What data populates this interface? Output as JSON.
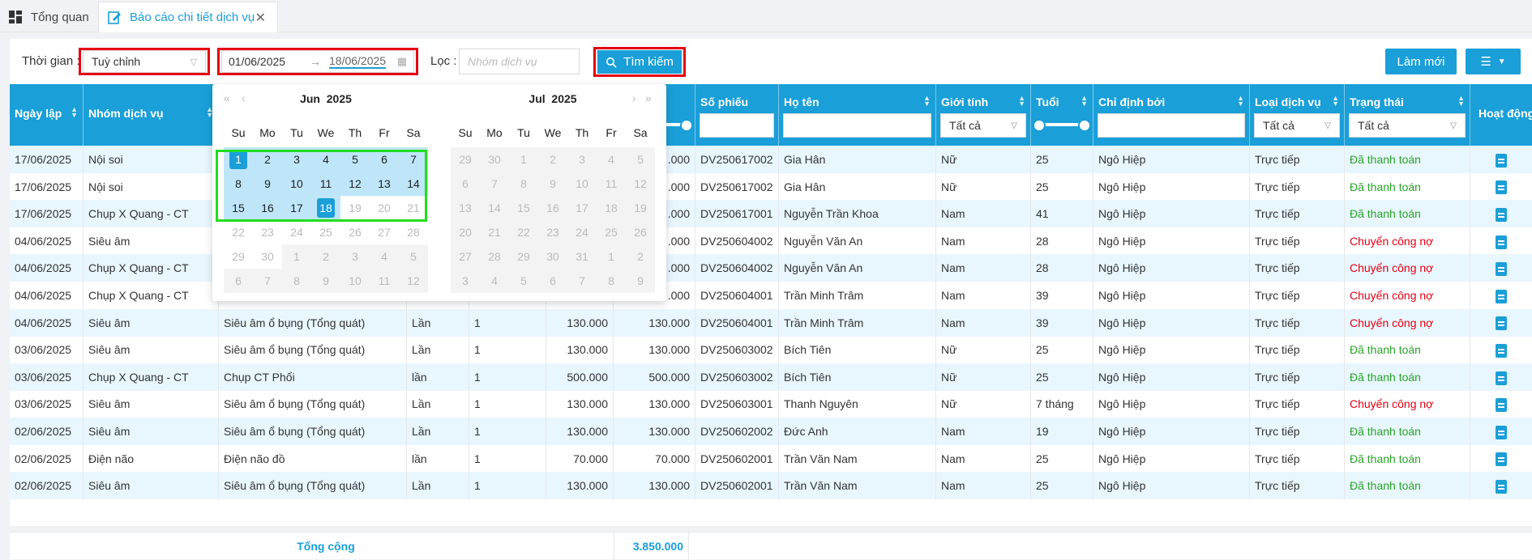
{
  "tabs": [
    {
      "label": "Tổng quan"
    },
    {
      "label": "Báo cáo chi tiết dịch vụ"
    }
  ],
  "filters": {
    "time_label": "Thời gian :",
    "time_value": "Tuỳ chỉnh",
    "date_from": "01/06/2025",
    "date_to": "18/06/2025",
    "filter_label": "Lọc :",
    "service_placeholder": "Nhóm dịch vụ",
    "search_label": "Tìm kiếm",
    "refresh_label": "Làm mới"
  },
  "table": {
    "headers": {
      "date": "Ngày lập",
      "group": "Nhóm dịch vụ",
      "ticket": "Số phiếu",
      "name": "Họ tên",
      "gender": "Giới tính",
      "age": "Tuổi",
      "assigned_by": "Chỉ định bởi",
      "service_type": "Loại dịch vụ",
      "status": "Trạng thái",
      "action": "Hoạt động"
    },
    "header_filters": {
      "gender": "Tất cả",
      "service_type": "Tất cả",
      "status": "Tất cả"
    },
    "rows": [
      {
        "date": "17/06/2025",
        "group": "Nội soi",
        "service": "",
        "unit": "",
        "qty": "",
        "price": "",
        "amount": ".000",
        "ticket": "DV250617002",
        "name": "Gia Hân",
        "gender": "Nữ",
        "age": "25",
        "by": "Ngô Hiệp",
        "type": "Trực tiếp",
        "status": "Đã thanh toán",
        "paid": true
      },
      {
        "date": "17/06/2025",
        "group": "Nội soi",
        "service": "",
        "unit": "",
        "qty": "",
        "price": "",
        "amount": ".000",
        "ticket": "DV250617002",
        "name": "Gia Hân",
        "gender": "Nữ",
        "age": "25",
        "by": "Ngô Hiệp",
        "type": "Trực tiếp",
        "status": "Đã thanh toán",
        "paid": true
      },
      {
        "date": "17/06/2025",
        "group": "Chụp X Quang - CT",
        "service": "",
        "unit": "",
        "qty": "",
        "price": "",
        "amount": ".000",
        "ticket": "DV250617001",
        "name": "Nguyễn Trần Khoa",
        "gender": "Nam",
        "age": "41",
        "by": "Ngô Hiệp",
        "type": "Trực tiếp",
        "status": "Đã thanh toán",
        "paid": true
      },
      {
        "date": "04/06/2025",
        "group": "Siêu âm",
        "service": "",
        "unit": "",
        "qty": "",
        "price": "",
        "amount": ".000",
        "ticket": "DV250604002",
        "name": "Nguyễn Văn An",
        "gender": "Nam",
        "age": "28",
        "by": "Ngô Hiệp",
        "type": "Trực tiếp",
        "status": "Chuyển công nợ",
        "paid": false
      },
      {
        "date": "04/06/2025",
        "group": "Chụp X Quang - CT",
        "service": "",
        "unit": "",
        "qty": "",
        "price": "",
        "amount": ".000",
        "ticket": "DV250604002",
        "name": "Nguyễn Văn An",
        "gender": "Nam",
        "age": "28",
        "by": "Ngô Hiệp",
        "type": "Trực tiếp",
        "status": "Chuyển công nợ",
        "paid": false
      },
      {
        "date": "04/06/2025",
        "group": "Chụp X Quang - CT",
        "service": "",
        "unit": "",
        "qty": "",
        "price": "",
        "amount": ".000",
        "ticket": "DV250604001",
        "name": "Trần Minh Trâm",
        "gender": "Nam",
        "age": "39",
        "by": "Ngô Hiệp",
        "type": "Trực tiếp",
        "status": "Chuyển công nợ",
        "paid": false
      },
      {
        "date": "04/06/2025",
        "group": "Siêu âm",
        "service": "Siêu âm ổ bụng (Tổng quát)",
        "unit": "Lần",
        "qty": "1",
        "price": "130.000",
        "amount": "130.000",
        "ticket": "DV250604001",
        "name": "Trần Minh Trâm",
        "gender": "Nam",
        "age": "39",
        "by": "Ngô Hiệp",
        "type": "Trực tiếp",
        "status": "Chuyển công nợ",
        "paid": false
      },
      {
        "date": "03/06/2025",
        "group": "Siêu âm",
        "service": "Siêu âm ổ bụng (Tổng quát)",
        "unit": "Lần",
        "qty": "1",
        "price": "130.000",
        "amount": "130.000",
        "ticket": "DV250603002",
        "name": "Bích Tiên",
        "gender": "Nữ",
        "age": "25",
        "by": "Ngô Hiệp",
        "type": "Trực tiếp",
        "status": "Đã thanh toán",
        "paid": true
      },
      {
        "date": "03/06/2025",
        "group": "Chụp X Quang - CT",
        "service": "Chụp CT Phổi",
        "unit": "lần",
        "qty": "1",
        "price": "500.000",
        "amount": "500.000",
        "ticket": "DV250603002",
        "name": "Bích Tiên",
        "gender": "Nữ",
        "age": "25",
        "by": "Ngô Hiệp",
        "type": "Trực tiếp",
        "status": "Đã thanh toán",
        "paid": true
      },
      {
        "date": "03/06/2025",
        "group": "Siêu âm",
        "service": "Siêu âm ổ bụng (Tổng quát)",
        "unit": "Lần",
        "qty": "1",
        "price": "130.000",
        "amount": "130.000",
        "ticket": "DV250603001",
        "name": "Thanh Nguyên",
        "gender": "Nữ",
        "age": "7 tháng",
        "by": "Ngô Hiệp",
        "type": "Trực tiếp",
        "status": "Chuyển công nợ",
        "paid": false
      },
      {
        "date": "02/06/2025",
        "group": "Siêu âm",
        "service": "Siêu âm ổ bụng (Tổng quát)",
        "unit": "Lần",
        "qty": "1",
        "price": "130.000",
        "amount": "130.000",
        "ticket": "DV250602002",
        "name": "Đức Anh",
        "gender": "Nam",
        "age": "19",
        "by": "Ngô Hiệp",
        "type": "Trực tiếp",
        "status": "Đã thanh toán",
        "paid": true
      },
      {
        "date": "02/06/2025",
        "group": "Điện não",
        "service": "Điện não đồ",
        "unit": "lần",
        "qty": "1",
        "price": "70.000",
        "amount": "70.000",
        "ticket": "DV250602001",
        "name": "Trần Văn Nam",
        "gender": "Nam",
        "age": "25",
        "by": "Ngô Hiệp",
        "type": "Trực tiếp",
        "status": "Đã thanh toán",
        "paid": true
      },
      {
        "date": "02/06/2025",
        "group": "Siêu âm",
        "service": "Siêu âm ổ bụng (Tổng quát)",
        "unit": "Lần",
        "qty": "1",
        "price": "130.000",
        "amount": "130.000",
        "ticket": "DV250602001",
        "name": "Trần Văn Nam",
        "gender": "Nam",
        "age": "25",
        "by": "Ngô Hiệp",
        "type": "Trực tiếp",
        "status": "Đã thanh toán",
        "paid": true
      }
    ],
    "total_label": "Tổng cộng",
    "total_value": "3.850.000"
  },
  "calendar": {
    "left_month": "Jun",
    "left_year": "2025",
    "right_month": "Jul",
    "right_year": "2025",
    "weekdays": [
      "Su",
      "Mo",
      "Tu",
      "We",
      "Th",
      "Fr",
      "Sa"
    ],
    "left_days": [
      [
        "1",
        "2",
        "3",
        "4",
        "5",
        "6",
        "7"
      ],
      [
        "8",
        "9",
        "10",
        "11",
        "12",
        "13",
        "14"
      ],
      [
        "15",
        "16",
        "17",
        "18",
        "19",
        "20",
        "21"
      ],
      [
        "22",
        "23",
        "24",
        "25",
        "26",
        "27",
        "28"
      ],
      [
        "29",
        "30",
        "1",
        "2",
        "3",
        "4",
        "5"
      ],
      [
        "6",
        "7",
        "8",
        "9",
        "10",
        "11",
        "12"
      ]
    ],
    "right_days": [
      [
        "29",
        "30",
        "1",
        "2",
        "3",
        "4",
        "5"
      ],
      [
        "6",
        "7",
        "8",
        "9",
        "10",
        "11",
        "12"
      ],
      [
        "13",
        "14",
        "15",
        "16",
        "17",
        "18",
        "19"
      ],
      [
        "20",
        "21",
        "22",
        "23",
        "24",
        "25",
        "26"
      ],
      [
        "27",
        "28",
        "29",
        "30",
        "31",
        "1",
        "2"
      ],
      [
        "3",
        "4",
        "5",
        "6",
        "7",
        "8",
        "9"
      ]
    ]
  },
  "colors": {
    "accent": "#1a9fd8",
    "paid": "#2aa52a",
    "debt": "#e60012"
  }
}
